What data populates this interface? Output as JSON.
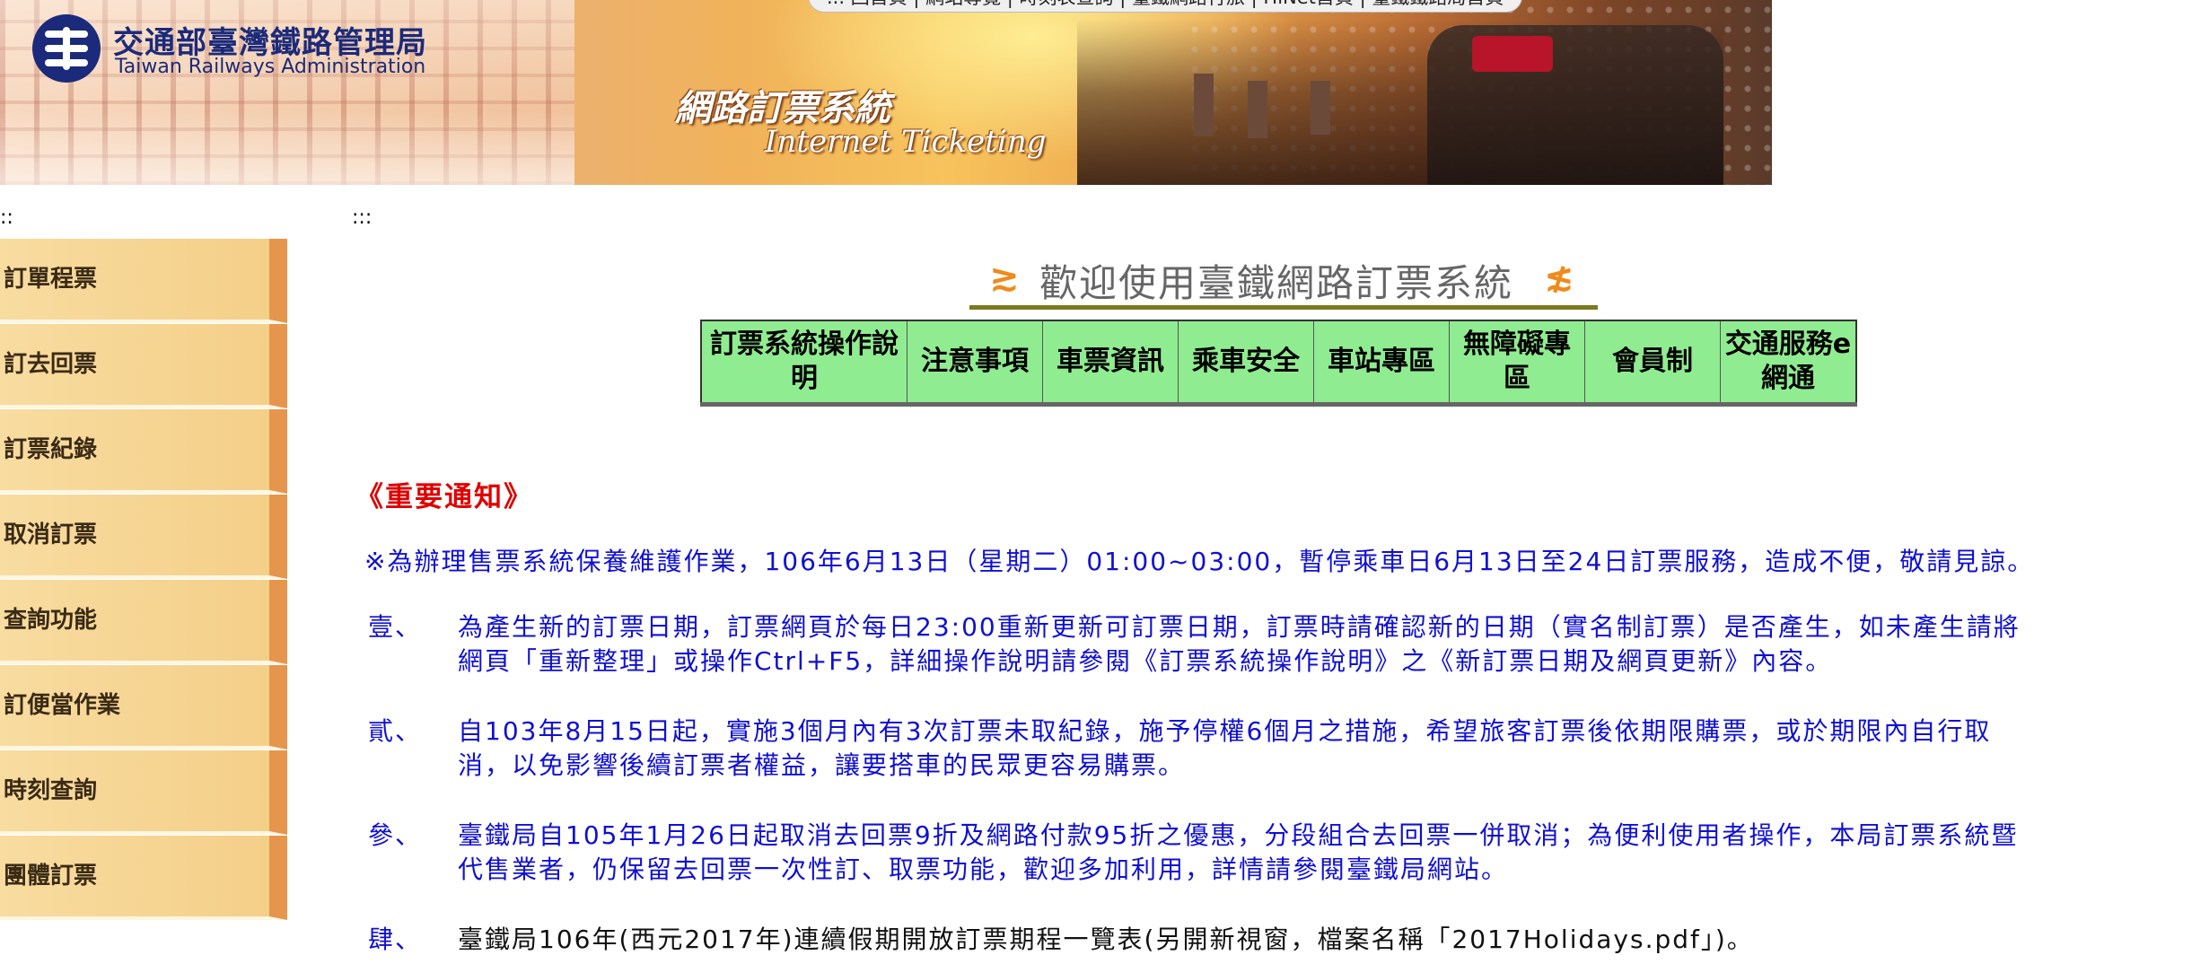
{
  "header": {
    "org_name_zh": "交通部臺灣鐵路管理局",
    "org_name_en": "Taiwan Railways Administration",
    "system_title_zh": "網路訂票系統",
    "system_title_en": "Internet Ticketing",
    "top_links": "... 回首頁 | 網站導覽 | 時刻表查詢 | 臺鐵網路行旅 | HiNet首頁 | 臺鐵鐵路局首頁"
  },
  "markers": {
    "sidebar": "::",
    "main": ":::"
  },
  "sidebar": {
    "items": [
      {
        "label": "訂單程票"
      },
      {
        "label": "訂去回票"
      },
      {
        "label": "訂票紀錄"
      },
      {
        "label": "取消訂票"
      },
      {
        "label": "查詢功能"
      },
      {
        "label": "訂便當作業"
      },
      {
        "label": "時刻查詢"
      },
      {
        "label": "團體訂票"
      }
    ]
  },
  "main": {
    "welcome": "歡迎使用臺鐵網路訂票系統",
    "nav": [
      {
        "label": "訂票系統操作說明"
      },
      {
        "label": "注意事項"
      },
      {
        "label": "車票資訊"
      },
      {
        "label": "乘車安全"
      },
      {
        "label": "車站專區"
      },
      {
        "label": "無障礙專區"
      },
      {
        "label": "會員制"
      },
      {
        "label": "交通服務e網通"
      }
    ],
    "notice_title": "《重要通知》",
    "notice_banner": "※為辦理售票系統保養維護作業，106年6月13日（星期二）01:00~03:00，暫停乘車日6月13日至24日訂票服務，造成不便，敬請見諒。",
    "notices": [
      {
        "num": "壹、",
        "line1": "為產生新的訂票日期，訂票網頁於每日23:00重新更新可訂票日期，訂票時請確認新的日期（實名制訂票）是否產生，如未產生請將",
        "line2": "網頁「重新整理」或操作Ctrl+F5，詳細操作說明請參閱《訂票系統操作說明》之《新訂票日期及網頁更新》內容。"
      },
      {
        "num": "貳、",
        "line1": "自103年8月15日起，實施3個月內有3次訂票未取紀錄，施予停權6個月之措施，希望旅客訂票後依期限購票，或於期限內自行取",
        "line2": "消，以免影響後續訂票者權益，讓要搭車的民眾更容易購票。"
      },
      {
        "num": "參、",
        "line1": "臺鐵局自105年1月26日起取消去回票9折及網路付款95折之優惠，分段組合去回票一併取消；為便利使用者操作，本局訂票系統暨",
        "line2": "代售業者，仍保留去回票一次性訂、取票功能，歡迎多加利用，詳情請參閱臺鐵局網站。"
      },
      {
        "num": "肆、",
        "line1": "臺鐵局106年(西元2017年)連續假期開放訂票期程一覽表(另開新視窗，檔案名稱「2017Holidays.pdf」)。",
        "line2": ""
      }
    ]
  },
  "colors": {
    "notice_blue": "#1010d0",
    "notice_red": "#e00000",
    "nav_green": "#90ec90",
    "sidebar_tan": "#f6d698",
    "sidebar_edge": "#e6964c"
  }
}
